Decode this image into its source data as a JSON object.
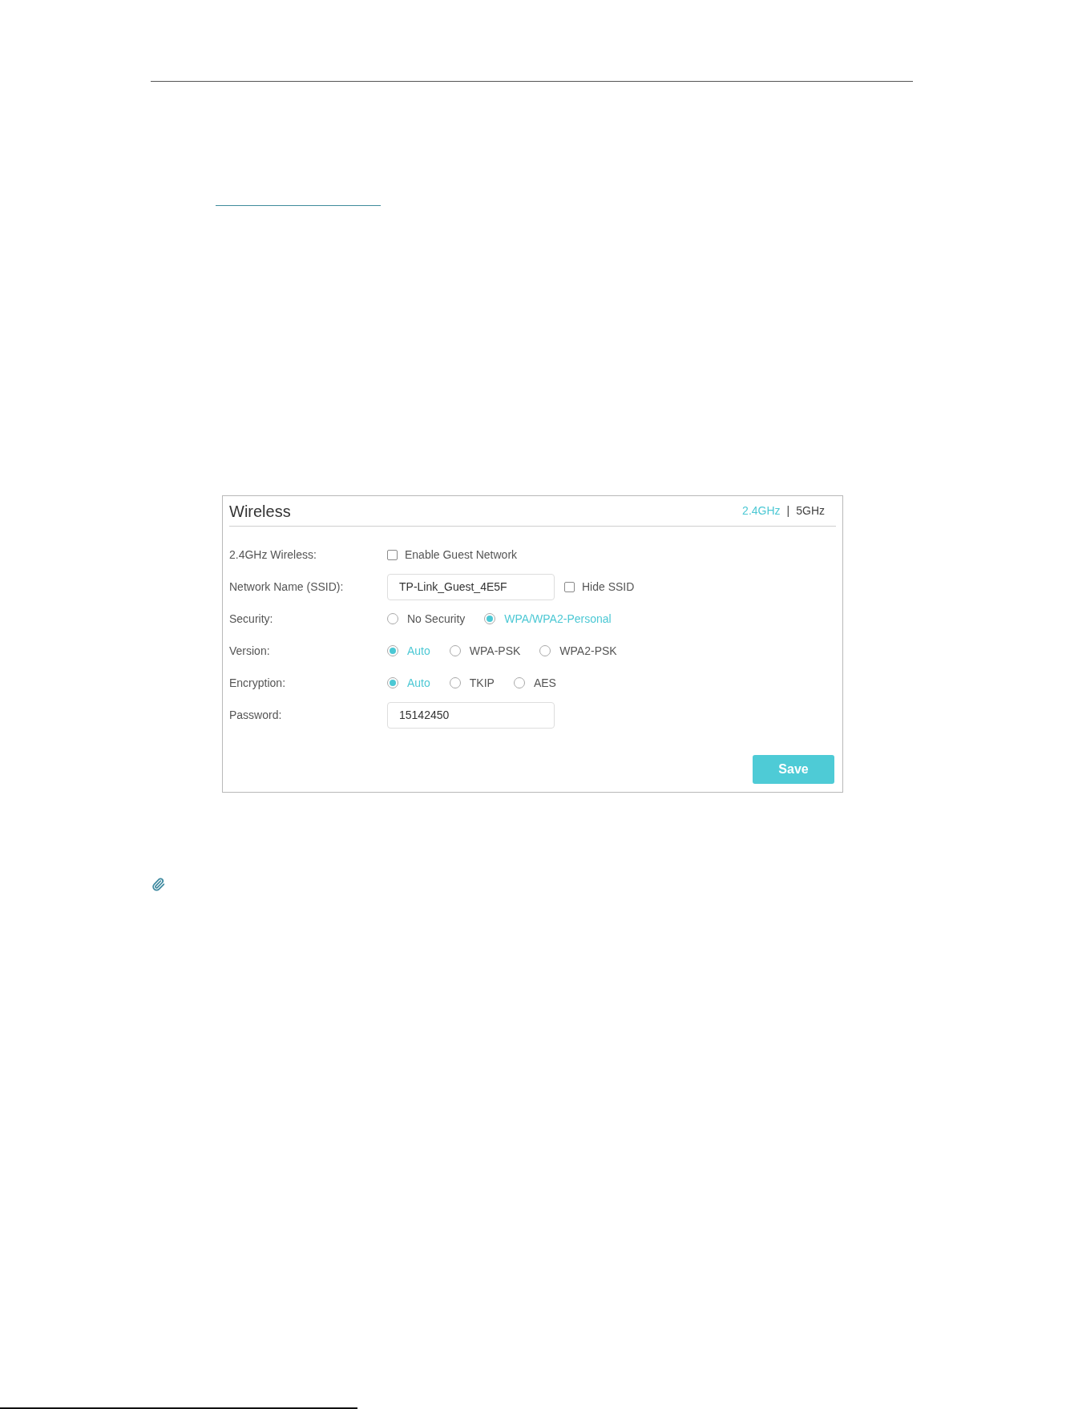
{
  "panel": {
    "title": "Wireless",
    "bands": [
      {
        "label": "2.4GHz",
        "selected": true
      },
      {
        "label": "5GHz",
        "selected": false
      }
    ],
    "band_separator": "|",
    "rows": [
      {
        "label": "2.4GHz Wireless:",
        "options": [
          {
            "kind": "checkbox",
            "label": "Enable Guest Network",
            "checked": false
          }
        ]
      },
      {
        "label": "Network Name (SSID):",
        "value": "TP-Link_Guest_4E5F",
        "options": [
          {
            "kind": "checkbox",
            "label": "Hide SSID",
            "checked": false
          }
        ]
      },
      {
        "label": "Security:",
        "options": [
          {
            "kind": "radio",
            "label": "No Security",
            "selected": false
          },
          {
            "kind": "radio",
            "label": "WPA/WPA2-Personal",
            "selected": true
          }
        ]
      },
      {
        "label": "Version:",
        "options": [
          {
            "kind": "radio",
            "label": "Auto",
            "selected": true
          },
          {
            "kind": "radio",
            "label": "WPA-PSK",
            "selected": false
          },
          {
            "kind": "radio",
            "label": "WPA2-PSK",
            "selected": false
          }
        ]
      },
      {
        "label": "Encryption:",
        "options": [
          {
            "kind": "radio",
            "label": "Auto",
            "selected": true
          },
          {
            "kind": "radio",
            "label": "TKIP",
            "selected": false
          },
          {
            "kind": "radio",
            "label": "AES",
            "selected": false
          }
        ]
      },
      {
        "label": "Password:",
        "value": "15142450"
      }
    ],
    "save_button": "Save"
  }
}
